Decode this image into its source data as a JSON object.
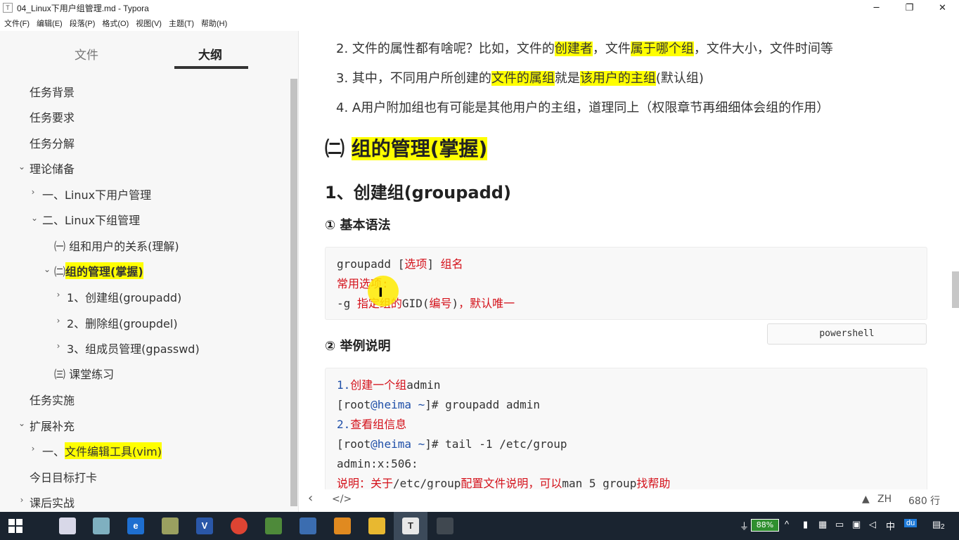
{
  "window": {
    "app_icon": "T",
    "title": "04_Linux下用户组管理.md - Typora",
    "minimize": "─",
    "restore": "❐",
    "close": "✕"
  },
  "menu": [
    "文件(F)",
    "编辑(E)",
    "段落(P)",
    "格式(O)",
    "视图(V)",
    "主题(T)",
    "帮助(H)"
  ],
  "sidebar": {
    "tab_files": "文件",
    "tab_outline": "大纲",
    "items": [
      {
        "label": "任务背景",
        "chev": ""
      },
      {
        "label": "任务要求",
        "chev": ""
      },
      {
        "label": "任务分解",
        "chev": ""
      },
      {
        "label": "理论储备",
        "chev": "⌄"
      },
      {
        "label": "一、Linux下用户管理",
        "chev": "›"
      },
      {
        "label": "二、Linux下组管理",
        "chev": "⌄"
      },
      {
        "label": "㈠ 组和用户的关系(理解)",
        "chev": ""
      },
      {
        "prefix": "㈡ ",
        "label": "组的管理(掌握)",
        "chev": "⌄"
      },
      {
        "label": "1、创建组(groupadd)",
        "chev": "›"
      },
      {
        "label": "2、删除组(groupdel)",
        "chev": "›"
      },
      {
        "label": "3、组成员管理(gpasswd)",
        "chev": "›"
      },
      {
        "label": "㈢ 课堂练习",
        "chev": ""
      },
      {
        "label": "任务实施",
        "chev": ""
      },
      {
        "label": "扩展补充",
        "chev": "⌄"
      },
      {
        "prefix": "一、",
        "label": "文件编辑工具(vim)",
        "chev": "›"
      },
      {
        "label": "今日目标打卡",
        "chev": ""
      },
      {
        "label": "课后实战",
        "chev": "›"
      }
    ]
  },
  "editor": {
    "p2": {
      "a": "2. 文件的属性都有啥呢？比如，文件的",
      "b": "创建者",
      "c": "，文件",
      "d": "属于哪个组",
      "e": "，文件大小，文件时间等"
    },
    "p3": {
      "a": "3. 其中，不同用户所创建的",
      "b": "文件的属组",
      "c": "就是",
      "d": "该用户的主组",
      "e": "(默认组)"
    },
    "p4": "4. A用户附加组也有可能是其他用户的主组，道理同上（权限章节再细细体会组的作用）",
    "h2_prefix": "㈡ ",
    "h2": "组的管理(掌握)",
    "h3": "1、创建组(groupadd)",
    "h4_syntax": "① 基本语法",
    "code1": {
      "l1a": "groupadd [",
      "l1b": "选项",
      "l1c": "] ",
      "l1d": "组名",
      "l2": "常用选项:",
      "l3a": "-g ",
      "l3b": "指定组的",
      "l3c": "GID(",
      "l3d": "编号",
      "l3e": ")",
      "l3f": "，默认唯一"
    },
    "lang": "powershell",
    "h4_example": "② 举例说明",
    "code2": {
      "l1a": "1.",
      "l1b": "创建一个组",
      "l1c": "admin",
      "l2a": "[root",
      "l2b": "@heima ~",
      "l2c": "]# groupadd admin",
      "l3a": "2.",
      "l3b": "查看组信息",
      "l4a": "[root",
      "l4b": "@heima ~",
      "l4c": "]# tail -1 /etc/group",
      "l5": "admin:x:506:",
      "l6a": "说明：关于",
      "l6b": "/etc/group",
      "l6c": "配置文件说明，可以",
      "l6d": "man 5 group",
      "l6e": "找帮助"
    }
  },
  "statusbar": {
    "back": "‹",
    "source": "</>",
    "warn": "▲",
    "lang": "ZH",
    "lines": "680 行"
  },
  "taskbar": {
    "battery": "88%",
    "tray_ime": "中",
    "tray_du": "du",
    "tray_notify": "2"
  }
}
